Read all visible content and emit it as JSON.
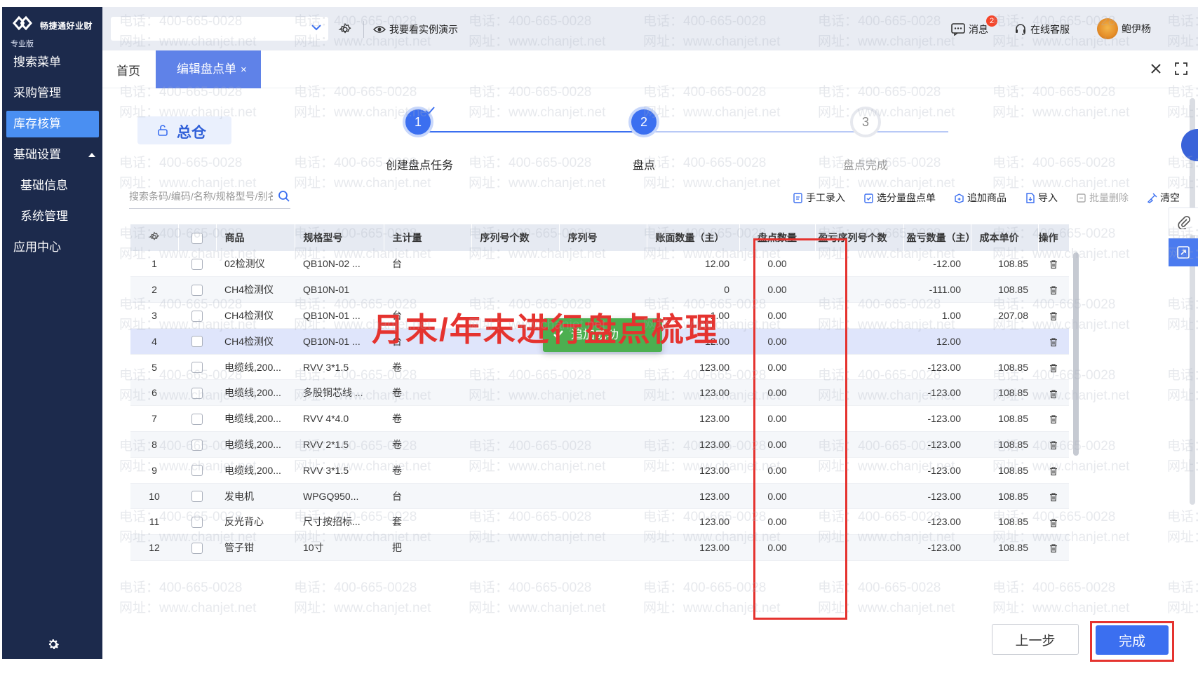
{
  "brand": {
    "name": "畅捷通好业财",
    "edition": "专业版"
  },
  "sidebar": {
    "items": [
      {
        "label": "搜索菜单"
      },
      {
        "label": "采购管理"
      },
      {
        "label": "库存核算"
      },
      {
        "label": "基础设置"
      },
      {
        "label": "基础信息"
      },
      {
        "label": "系统管理"
      },
      {
        "label": "应用中心"
      }
    ]
  },
  "header": {
    "demo_label": "我要看实例演示",
    "messages_label": "消息",
    "messages_badge": "2",
    "service_label": "在线客服",
    "user_name": "鲍伊杨"
  },
  "tabs": {
    "home": "首页",
    "active": "编辑盘点单",
    "active_close": "×"
  },
  "warehouse": {
    "label": "总仓"
  },
  "steps": [
    {
      "number": "1",
      "label": "创建盘点任务",
      "state": "done"
    },
    {
      "number": "2",
      "label": "盘点",
      "state": "current"
    },
    {
      "number": "3",
      "label": "盘点完成",
      "state": "pending"
    }
  ],
  "search": {
    "placeholder": "搜索条码/编码/名称/规格型号/别名"
  },
  "toolbar": {
    "manual_entry": "手工录入",
    "select_batch": "选分量盘点单",
    "add_goods": "追加商品",
    "import": "导入",
    "batch_delete": "批量删除",
    "clear": "清空"
  },
  "table": {
    "columns": [
      "商品",
      "规格型号",
      "主计量",
      "序列号个数",
      "序列号",
      "账面数量（主）",
      "盘点数量",
      "盈亏序列号个数",
      "盈亏数量（主）",
      "成本单价",
      "操作"
    ],
    "rows": [
      {
        "no": "1",
        "name": "02检测仪",
        "spec": "QB10N-02 ...",
        "unit": "台",
        "book": "12.00",
        "count": "0.00",
        "diff": "-12.00",
        "cost": "108.85"
      },
      {
        "no": "2",
        "name": "CH4检测仪",
        "spec": "QB10N-01",
        "unit": "",
        "book": "0",
        "count": "0.00",
        "diff": "-111.00",
        "cost": "108.85"
      },
      {
        "no": "3",
        "name": "CH4检测仪",
        "spec": "QB10N-01 ...",
        "unit": "台",
        "book": "-1.00",
        "count": "0.00",
        "diff": "1.00",
        "cost": "207.08"
      },
      {
        "no": "4",
        "name": "CH4检测仪",
        "spec": "QB10N-01 ...",
        "unit": "台",
        "book": "-12.00",
        "count": "0.00",
        "diff": "12.00",
        "cost": ""
      },
      {
        "no": "5",
        "name": "电缆线,200...",
        "spec": "RVV 3*1.5",
        "unit": "卷",
        "book": "123.00",
        "count": "0.00",
        "diff": "-123.00",
        "cost": "108.85"
      },
      {
        "no": "6",
        "name": "电缆线,200...",
        "spec": "多股铜芯线 ...",
        "unit": "卷",
        "book": "123.00",
        "count": "0.00",
        "diff": "-123.00",
        "cost": "108.85"
      },
      {
        "no": "7",
        "name": "电缆线,200...",
        "spec": "RVV 4*4.0",
        "unit": "卷",
        "book": "123.00",
        "count": "0.00",
        "diff": "-123.00",
        "cost": "108.85"
      },
      {
        "no": "8",
        "name": "电缆线,200...",
        "spec": "RVV 2*1.5",
        "unit": "卷",
        "book": "123.00",
        "count": "0.00",
        "diff": "-123.00",
        "cost": "108.85"
      },
      {
        "no": "9",
        "name": "电缆线,200...",
        "spec": "RVV 3*1.5",
        "unit": "卷",
        "book": "123.00",
        "count": "0.00",
        "diff": "-123.00",
        "cost": "108.85"
      },
      {
        "no": "10",
        "name": "发电机",
        "spec": "WPGQ950...",
        "unit": "台",
        "book": "123.00",
        "count": "0.00",
        "diff": "-123.00",
        "cost": "108.85"
      },
      {
        "no": "11",
        "name": "反光背心",
        "spec": "尺寸按招标...",
        "unit": "套",
        "book": "123.00",
        "count": "0.00",
        "diff": "-123.00",
        "cost": "108.85"
      },
      {
        "no": "12",
        "name": "管子钳",
        "spec": "10寸",
        "unit": "把",
        "book": "123.00",
        "count": "0.00",
        "diff": "-123.00",
        "cost": "108.85"
      }
    ]
  },
  "toast": {
    "label": "追加成功"
  },
  "annotation": {
    "text": "月末/年末进行盘点梳理"
  },
  "footer": {
    "prev": "上一步",
    "finish": "完成"
  },
  "watermark": {
    "line1": "电话：400-665-0028",
    "line2": "网址：www.chanjet.net"
  },
  "colors": {
    "primary": "#3b6ff0",
    "sidebar": "#1c2a4c",
    "highlight": "#e5332f",
    "toast": "#4caf50"
  }
}
